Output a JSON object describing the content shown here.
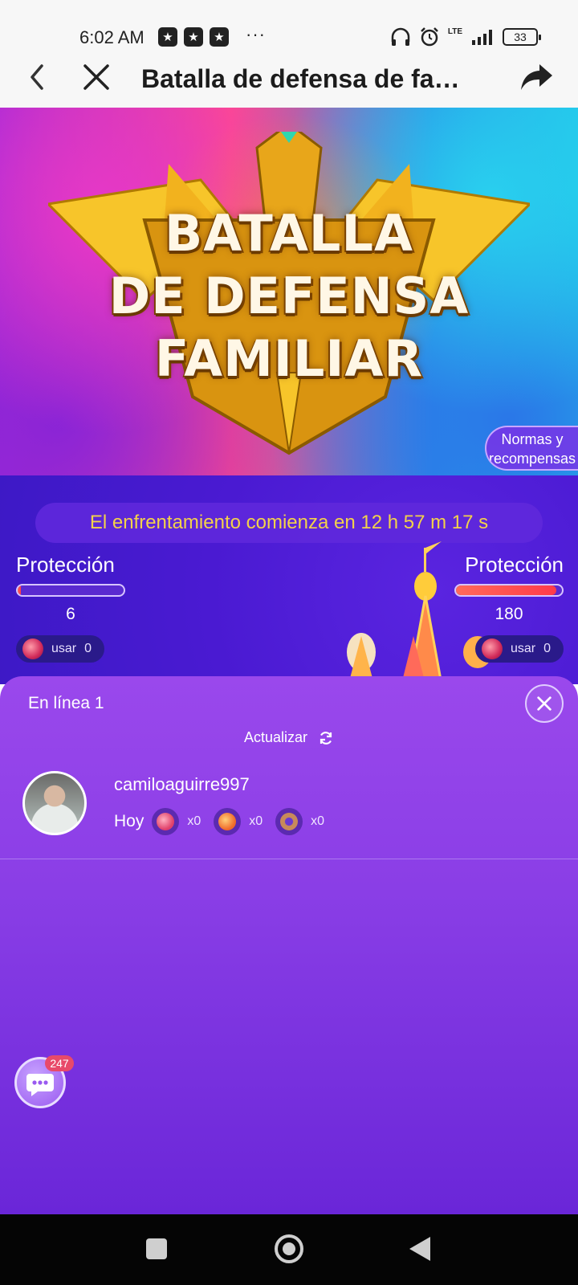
{
  "status_bar": {
    "time": "6:02 AM",
    "dots": "···",
    "network": "LTE",
    "battery": "33"
  },
  "nav": {
    "title": "Batalla de defensa de fa…"
  },
  "banner": {
    "title_lines": [
      "BATALLA",
      "DE DEFENSA",
      "FAMILIAR"
    ],
    "rules_button": "Normas y recompensas"
  },
  "battle": {
    "countdown": "El enfrentamiento comienza en 12 h 57 m 17 s",
    "left": {
      "label": "Protección",
      "value": "6",
      "fill_percent": 3,
      "use_label": "usar",
      "use_count": "0"
    },
    "right": {
      "label": "Protección",
      "value": "180",
      "fill_percent": 95,
      "use_label": "usar",
      "use_count": "0"
    }
  },
  "sheet": {
    "online": "En línea 1",
    "refresh": "Actualizar",
    "users": [
      {
        "name": "camiloaguirre997",
        "day": "Hoy",
        "items": [
          {
            "icon": "red-gem-icon",
            "count": "x0",
            "color": "#e0406a"
          },
          {
            "icon": "fire-scroll-icon",
            "count": "x0",
            "color": "#f06a2a"
          },
          {
            "icon": "shield-ring-icon",
            "count": "x0",
            "color": "#c88a5a"
          }
        ]
      }
    ]
  },
  "chat": {
    "badge": "247"
  },
  "colors": {
    "accent_yellow": "#f3d24a",
    "sheet_purple": "#8a3ee6",
    "battle_blue": "#4a1ad2"
  }
}
